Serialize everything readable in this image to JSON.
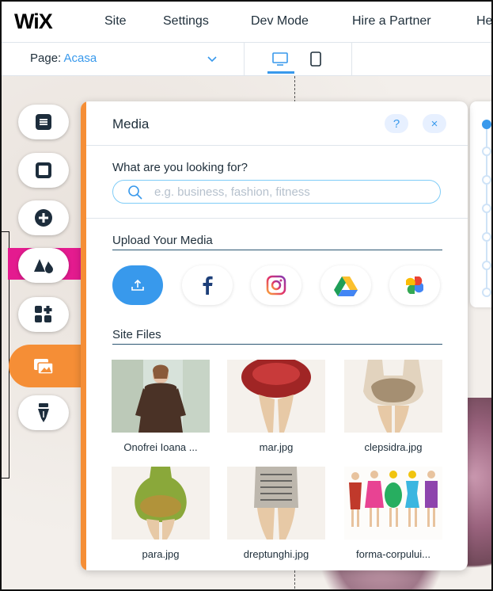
{
  "topbar": {
    "logo": "WiX",
    "menu": [
      "Site",
      "Settings",
      "Dev Mode",
      "Hire a Partner",
      "He"
    ]
  },
  "pagebar": {
    "page_prefix": "Page: ",
    "page_name": "Acasa",
    "devices": [
      "desktop-icon",
      "mobile-icon"
    ]
  },
  "toolbar": {
    "items": [
      "menus-pages-icon",
      "background-icon",
      "add-icon",
      "design-icon",
      "app-market-icon",
      "media-icon",
      "blog-icon"
    ],
    "active": "media-icon"
  },
  "panel": {
    "title": "Media",
    "help_label": "?",
    "close_label": "×",
    "search": {
      "label": "What are you looking for?",
      "placeholder": "e.g. business, fashion, fitness"
    },
    "upload_section": {
      "title": "Upload Your Media",
      "sources": [
        "upload-icon",
        "facebook-icon",
        "instagram-icon",
        "google-drive-icon",
        "google-photos-icon"
      ]
    },
    "files_section": {
      "title": "Site Files",
      "files": [
        {
          "name": "Onofrei Ioana ..."
        },
        {
          "name": "mar.jpg"
        },
        {
          "name": "clepsidra.jpg"
        },
        {
          "name": "para.jpg"
        },
        {
          "name": "dreptunghi.jpg"
        },
        {
          "name": "forma-corpului..."
        }
      ]
    }
  },
  "colors": {
    "accent_orange": "#f58e36",
    "accent_blue": "#3899ec",
    "highlight_pink": "#e41b8f",
    "text_dark": "#20303c"
  }
}
